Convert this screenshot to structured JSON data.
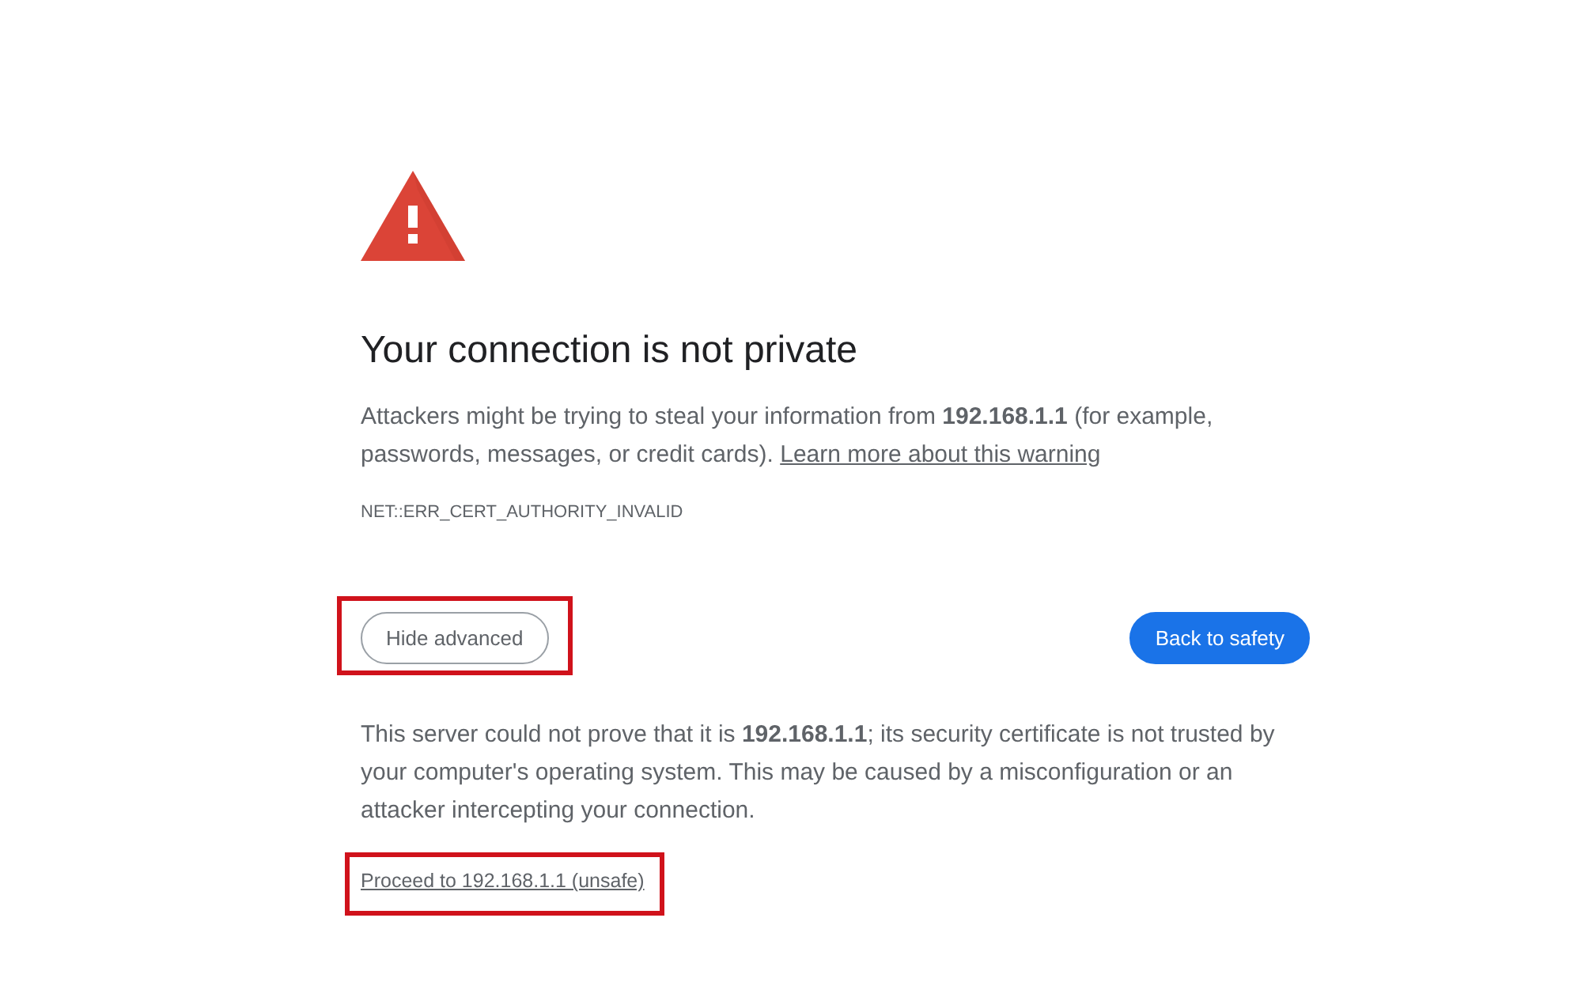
{
  "heading": "Your connection is not private",
  "message": {
    "text": "Attackers might be trying to steal your information from **192.168.1.1** (for example, passwords, messages, or credit cards).",
    "link": "Learn more about this warning"
  },
  "error_code": "NET::ERR_CERT_AUTHORITY_INVALID",
  "buttons": [
    {
      "label": "Hide advanced",
      "kind": "secondary",
      "highlighted": true
    },
    {
      "label": "Back to safety",
      "kind": "primary",
      "highlighted": false
    }
  ],
  "details": "This server could not prove that it is **192.168.1.1**; its security certificate is not trusted by your computer's operating system. This may be caused by a misconfiguration or an attacker intercepting your connection.",
  "proceed_link": {
    "label": "Proceed to 192.168.1.1 (unsafe)",
    "highlighted": true
  }
}
